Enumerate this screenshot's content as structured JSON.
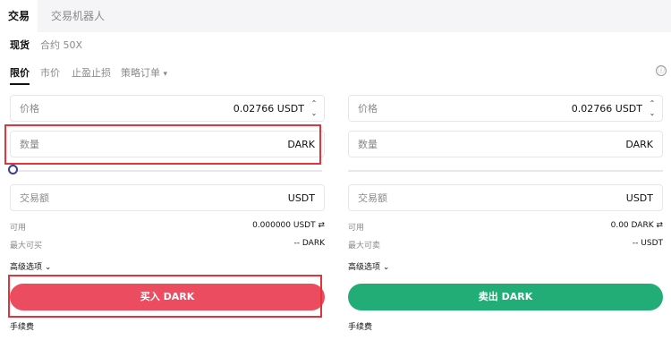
{
  "top_tabs": {
    "trade": "交易",
    "bot": "交易机器人"
  },
  "market_tabs": {
    "spot": "现货",
    "contract": "合约 50X"
  },
  "order_tabs": {
    "limit": "限价",
    "market": "市价",
    "tpsl": "止盈止损",
    "strategy": "策略订单",
    "strategy_arrow": "▾"
  },
  "info_icon": "ⓘ",
  "buy": {
    "price_label": "价格",
    "price_value": "0.02766 USDT",
    "qty_label": "数量",
    "qty_unit": "DARK",
    "amount_label": "交易额",
    "amount_unit": "USDT",
    "available_label": "可用",
    "available_value": "0.000000 USDT ⇄",
    "max_label": "最大可买",
    "max_value": "-- DARK",
    "advanced": "高级选项 ⌄",
    "button": "买入 DARK",
    "fee": "手续费"
  },
  "sell": {
    "price_label": "价格",
    "price_value": "0.02766 USDT",
    "qty_label": "数量",
    "qty_unit": "DARK",
    "amount_label": "交易额",
    "amount_unit": "USDT",
    "available_label": "可用",
    "available_value": "0.00 DARK ⇄",
    "max_label": "最大可卖",
    "max_value": "-- USDT",
    "advanced": "高级选项 ⌄",
    "button": "卖出 DARK",
    "fee": "手续费"
  },
  "spinner": {
    "up": "⌃",
    "down": "⌄"
  },
  "colors": {
    "buy": "#ec4c5f",
    "sell": "#22ad76",
    "highlight": "#e3343c"
  }
}
